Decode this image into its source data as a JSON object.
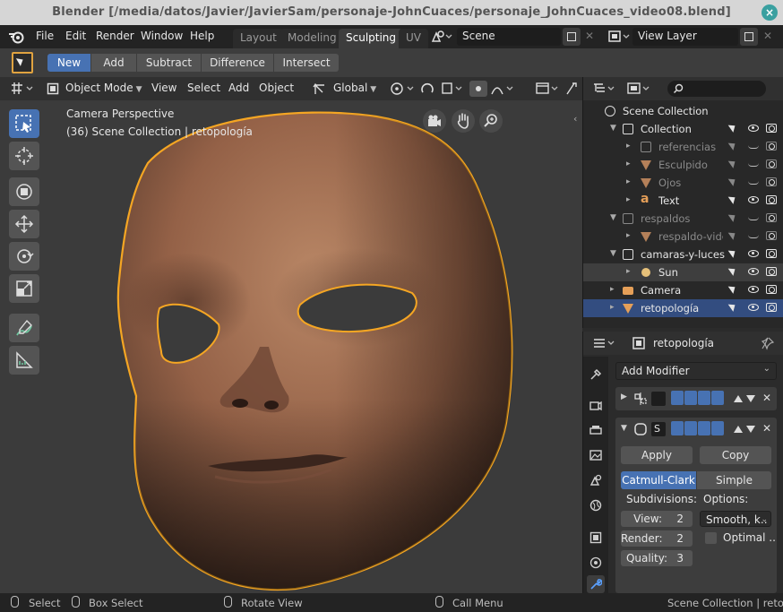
{
  "window": {
    "title": "Blender [/media/datos/Javier/JavierSam/personaje-JohnCuaces/personaje_JohnCuaces_video08.blend]",
    "close_glyph": "×"
  },
  "topmenu": {
    "items": [
      "File",
      "Edit",
      "Render",
      "Window",
      "Help"
    ],
    "workspace_tabs": [
      "Layout",
      "Modeling",
      "Sculpting",
      "UV"
    ],
    "active_tab": "Sculpting",
    "scene": "Scene",
    "view_layer": "View Layer"
  },
  "toolheader": {
    "modes": [
      "New",
      "Add",
      "Subtract",
      "Difference",
      "Intersect"
    ],
    "active_mode": "New"
  },
  "viewport_header": {
    "mode": "Object Mode",
    "menus": [
      "View",
      "Select",
      "Add",
      "Object"
    ],
    "orientation": "Global"
  },
  "viewport": {
    "camera_label": "Camera Perspective",
    "collection_label": "(36) Scene Collection | retopología"
  },
  "outliner": {
    "rows": [
      {
        "label": "Scene Collection",
        "icon": "scene-collection-icon"
      },
      {
        "label": "Collection",
        "icon": "collection-icon"
      },
      {
        "label": "referencias",
        "icon": "collection-icon"
      },
      {
        "label": "Esculpido",
        "icon": "mesh-icon"
      },
      {
        "label": "Ojos",
        "icon": "mesh-icon"
      },
      {
        "label": "Text",
        "icon": "text-icon"
      },
      {
        "label": "respaldos",
        "icon": "collection-icon"
      },
      {
        "label": "respaldo-video",
        "icon": "mesh-icon"
      },
      {
        "label": "camaras-y-luces",
        "icon": "collection-icon"
      },
      {
        "label": "Sun",
        "icon": "light-icon"
      },
      {
        "label": "Camera",
        "icon": "camera-icon"
      },
      {
        "label": "retopología",
        "icon": "mesh-icon"
      }
    ]
  },
  "properties": {
    "object_name": "retopología",
    "add_modifier": "Add Modifier",
    "mod2_name": "S",
    "apply": "Apply",
    "copy": "Copy",
    "catmull": "Catmull-Clark",
    "simple": "Simple",
    "subdivisions_label": "Subdivisions:",
    "options_label": "Options:",
    "view_label": "View:",
    "view_value": "2",
    "render_label": "Render:",
    "render_value": "2",
    "quality_label": "Quality:",
    "quality_value": "3",
    "uv_smooth": "Smooth, k..",
    "optimal": "Optimal .."
  },
  "statusbar": {
    "select": "Select",
    "box_select": "Box Select",
    "rotate_view": "Rotate View",
    "call_menu": "Call Menu",
    "stats": "Scene Collection | retopolo"
  },
  "colors": {
    "accent": "#4772b3",
    "selection_outline": "#f5a623",
    "face_skin": "#9a6a4e"
  }
}
